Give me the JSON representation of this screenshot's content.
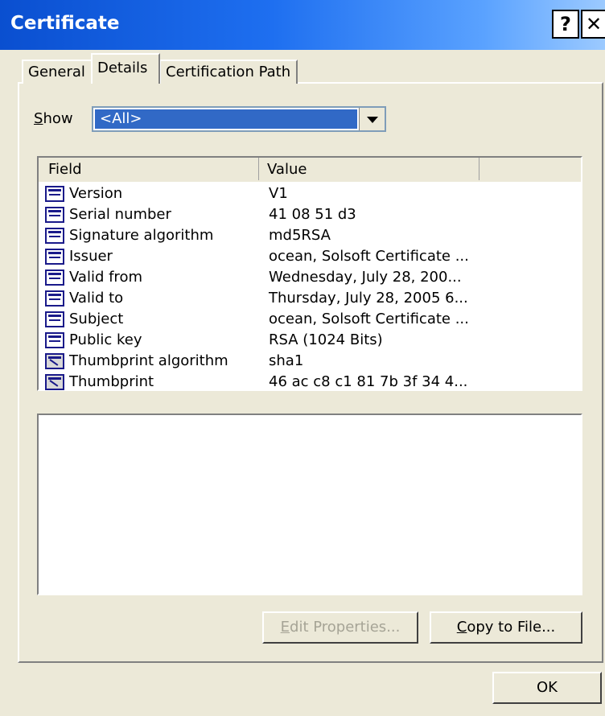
{
  "window": {
    "title": "Certificate",
    "help_label": "?",
    "close_label": "✕"
  },
  "tabs": [
    {
      "label": "General",
      "active": false
    },
    {
      "label": "Details",
      "active": true
    },
    {
      "label": "Certification Path",
      "active": false
    }
  ],
  "show": {
    "label_prefix": "S",
    "label_rest": "how",
    "selected": "<All>"
  },
  "table": {
    "columns": [
      "Field",
      "Value",
      ""
    ],
    "rows": [
      {
        "field": "Version",
        "value": "V1",
        "icon": "field-icon"
      },
      {
        "field": "Serial number",
        "value": "41 08 51 d3",
        "icon": "field-icon"
      },
      {
        "field": "Signature algorithm",
        "value": "md5RSA",
        "icon": "field-icon"
      },
      {
        "field": "Issuer",
        "value": "ocean, Solsoft Certificate ...",
        "icon": "field-icon"
      },
      {
        "field": "Valid from",
        "value": "Wednesday, July 28, 200...",
        "icon": "field-icon"
      },
      {
        "field": "Valid to",
        "value": "Thursday, July 28, 2005 6...",
        "icon": "field-icon"
      },
      {
        "field": "Subject",
        "value": "ocean, Solsoft Certificate ...",
        "icon": "field-icon"
      },
      {
        "field": "Public key",
        "value": "RSA (1024 Bits)",
        "icon": "field-icon"
      },
      {
        "field": "Thumbprint algorithm",
        "value": "sha1",
        "icon": "thumbprint-icon"
      },
      {
        "field": "Thumbprint",
        "value": "46 ac c8 c1 81 7b 3f 34 4...",
        "icon": "thumbprint-icon"
      }
    ]
  },
  "buttons": {
    "edit_prefix": "E",
    "edit_rest": "dit Properties...",
    "copy_prefix": "C",
    "copy_rest": "opy to File...",
    "ok": "OK"
  },
  "colors": {
    "titlebar": "#0a4fd0",
    "selection": "#3169c6",
    "dialog_bg": "#ece9d8"
  }
}
